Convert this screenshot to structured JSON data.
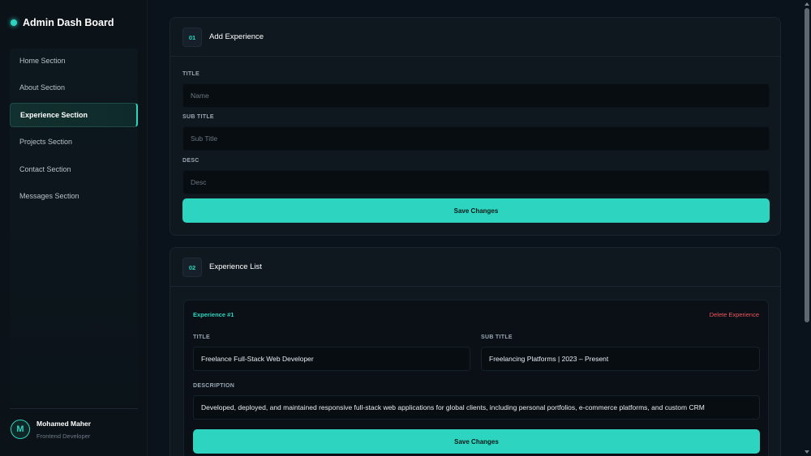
{
  "brand": {
    "title": "Admin Dash Board"
  },
  "sidebar": {
    "items": [
      {
        "label": "Home Section"
      },
      {
        "label": "About Section"
      },
      {
        "label": "Experience Section",
        "active": true
      },
      {
        "label": "Projects Section"
      },
      {
        "label": "Contact Section"
      },
      {
        "label": "Messages Section"
      }
    ]
  },
  "user": {
    "initial": "M",
    "name": "Mohamed Maher",
    "role": "Frontend Developer"
  },
  "add_card": {
    "number": "01",
    "title": "Add Experience",
    "title_label": "TITLE",
    "title_placeholder": "Name",
    "subtitle_label": "SUB TITLE",
    "subtitle_placeholder": "Sub Title",
    "desc_label": "DESC",
    "desc_placeholder": "Desc",
    "save_label": "Save Changes"
  },
  "list_card": {
    "number": "02",
    "title": "Experience List",
    "items": [
      {
        "name": "Experience #1",
        "delete_label": "Delete Experience",
        "title_label": "TITLE",
        "title_value": "Freelance Full-Stack Web Developer",
        "subtitle_label": "SUB TITLE",
        "subtitle_value": "Freelancing Platforms | 2023 – Present",
        "desc_label": "DESCRIPTION",
        "desc_value": "Developed, deployed, and maintained responsive full-stack web applications for global clients, including personal portfolios, e-commerce platforms, and custom CRM",
        "save_label": "Save Changes"
      }
    ]
  },
  "colors": {
    "accent": "#2dd4bf",
    "danger": "#f0555f",
    "background": "#0a131c"
  }
}
